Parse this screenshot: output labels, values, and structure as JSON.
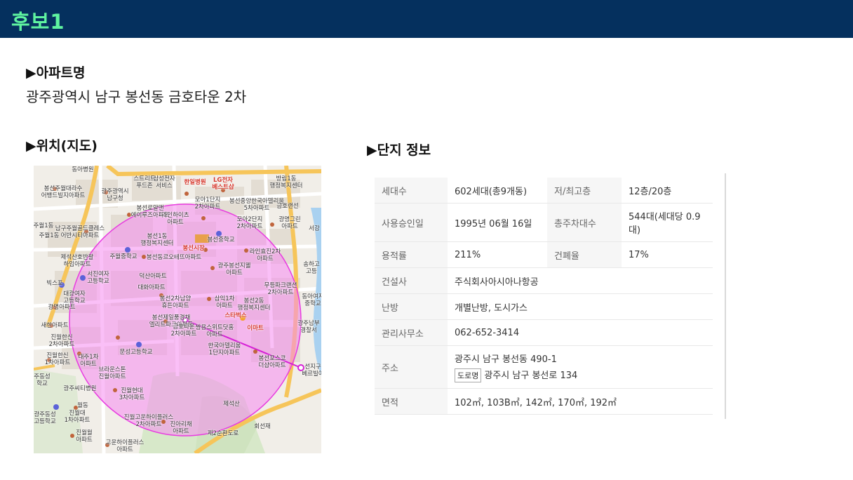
{
  "header": {
    "title": "후보1"
  },
  "apartment": {
    "heading": "▶아파트명",
    "name": "광주광역시 남구 봉선동 금호타운 2차"
  },
  "location": {
    "heading": "▶위치(지도)"
  },
  "map": {
    "labels": [
      {
        "t": "동아병원"
      },
      {
        "t": "스트리트\n푸드존"
      },
      {
        "t": "삼성전자\n서비스"
      },
      {
        "t": "한일병원"
      },
      {
        "t": "LG전자\n베스트샵"
      },
      {
        "t": "봉선주월대라수\n어뱅드빌지아파트"
      },
      {
        "t": "광주광역시\n남구청"
      },
      {
        "t": "모아1단지\n2차아파트"
      },
      {
        "t": "봉선중앙한국아델리움\n5차아파트"
      },
      {
        "t": "금호랜선"
      },
      {
        "t": "봉선로얄맨\n에이루즈아파트"
      },
      {
        "t": "라인하이츠\n아파트"
      },
      {
        "t": "모아2단지\n2차아파트"
      },
      {
        "t": "광명그린\n아파트"
      },
      {
        "t": "주월1동"
      },
      {
        "t": "남구주월골드클레스\n어반시티아파트"
      },
      {
        "t": "봉선1동\n행정복지센터"
      },
      {
        "t": "봉선시장"
      },
      {
        "t": "봉선중학교"
      },
      {
        "t": "제석산호반팔\n하임아파트"
      },
      {
        "t": "주월중학교"
      },
      {
        "t": "봉선동르오테뜨아파트"
      },
      {
        "t": "라인효진2차\n아파트"
      },
      {
        "t": "빅스포"
      },
      {
        "t": "서진여자\n고등학교"
      },
      {
        "t": "덕산아파트"
      },
      {
        "t": "광주봉선지웰\n아파트"
      },
      {
        "t": "대광여자\n고등학교"
      },
      {
        "t": "대화아파트"
      },
      {
        "t": "봉선2차남양\n휴튼아파트"
      },
      {
        "t": "무등파크랜션\n2차아파트"
      },
      {
        "t": "광명아파트"
      },
      {
        "t": "삼익1차\n아파트"
      },
      {
        "t": "봉선2동\n행정복지센터"
      },
      {
        "t": "봉선제일풍경채\n엘리트파크아파트"
      },
      {
        "t": "스타벅스"
      },
      {
        "t": "새한아파트"
      },
      {
        "t": "금호타운\n2차아파트"
      },
      {
        "t": "쌍용스위트닷홈\n아파트"
      },
      {
        "t": "이마트"
      },
      {
        "t": "광주남부\n경찰서"
      },
      {
        "t": "진월한신\n2차아파트"
      },
      {
        "t": "문성고등학교"
      },
      {
        "t": "한국아델리움\n1단지아파트"
      },
      {
        "t": "진월한신\n1차아파트"
      },
      {
        "t": "대주1차\n아파트"
      },
      {
        "t": "봉선포스코\n더샵아파트"
      },
      {
        "t": "선지구\n베르빌아"
      },
      {
        "t": "주동성\n학교"
      },
      {
        "t": "브라운스톤\n진월아파트"
      },
      {
        "t": "광주씨티병원"
      },
      {
        "t": "진월현대\n3차아파트"
      },
      {
        "t": "제석산"
      },
      {
        "t": "월동"
      },
      {
        "t": "광주동성\n고등학교"
      },
      {
        "t": "진월대\n1차아파트"
      },
      {
        "t": "진월고운하이플러스\n2차아파트"
      },
      {
        "t": "진아리채\n아파트"
      },
      {
        "t": "진월월\n아파트"
      },
      {
        "t": "고운하이플러스\n아파트"
      },
      {
        "t": "제2순환도로"
      },
      {
        "t": "회선재"
      },
      {
        "t": "방림1동\n행정복지센터"
      },
      {
        "t": "송하고\n고등"
      },
      {
        "t": "동아여자\n중학교"
      },
      {
        "t": "서강"
      },
      {
        "t": "주월1동"
      }
    ]
  },
  "complex": {
    "heading": "▶단지 정보",
    "rows": [
      {
        "label": "세대수",
        "value": "602세대(총9개동)",
        "label2": "저/최고층",
        "value2": "12층/20층"
      },
      {
        "label": "사용승인일",
        "value": "1995년 06월 16일",
        "label2": "총주차대수",
        "value2": "544대(세대당 0.9대)"
      },
      {
        "label": "용적률",
        "value": "211%",
        "label2": "건폐율",
        "value2": "17%"
      },
      {
        "label": "건설사",
        "value": "주식회사아시아나항공"
      },
      {
        "label": "난방",
        "value": "개별난방, 도시가스"
      },
      {
        "label": "관리사무소",
        "value": "062-652-3414"
      },
      {
        "label": "주소",
        "value": "광주시 남구 봉선동 490-1",
        "road_tag": "도로명",
        "road_value": "광주시 남구 봉선로 134"
      },
      {
        "label": "면적",
        "value": "102㎡, 103B㎡, 142㎡, 170㎡, 192㎡"
      }
    ]
  },
  "colors": {
    "header_bg": "#05305e",
    "header_text": "#5ff3a0",
    "radius_fill": "#f58bf0",
    "radius_line": "#e83be0"
  }
}
